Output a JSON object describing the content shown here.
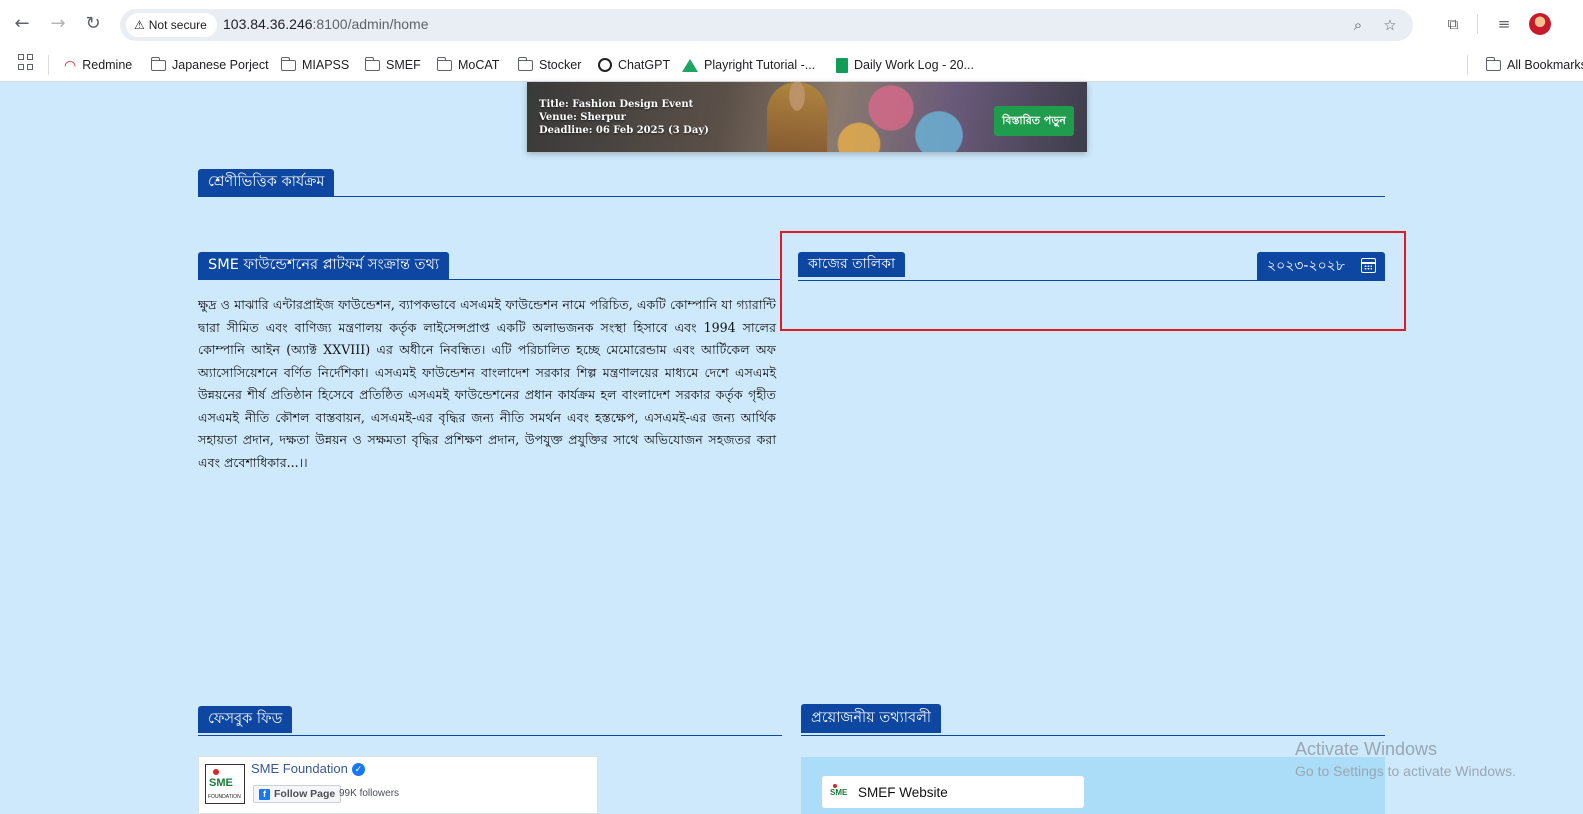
{
  "browser": {
    "security_label": "Not secure",
    "url_host": "103.84.36.246",
    "url_rest": ":8100/admin/home",
    "bookmarks": [
      {
        "label": "Redmine",
        "icon": "redmine-icon"
      },
      {
        "label": "Japanese Porject",
        "icon": "folder-icon"
      },
      {
        "label": "MIAPSS",
        "icon": "folder-icon"
      },
      {
        "label": "SMEF",
        "icon": "folder-icon"
      },
      {
        "label": "MoCAT",
        "icon": "folder-icon"
      },
      {
        "label": "Stocker",
        "icon": "folder-icon"
      },
      {
        "label": "ChatGPT",
        "icon": "chatgpt-icon"
      },
      {
        "label": "Playright Tutorial -...",
        "icon": "google-drive-icon"
      },
      {
        "label": "Daily Work Log - 20...",
        "icon": "google-sheets-icon"
      }
    ],
    "all_bookmarks": "All Bookmarks"
  },
  "event": {
    "title": "Title: Fashion Design Event",
    "venue": "Venue: Sherpur",
    "deadline": "Deadline: 06 Feb 2025 (3 Day)",
    "button": "বিস্তারিত পড়ুন"
  },
  "sections": {
    "category": "শ্রেণীভিত্তিক কার্যক্রম",
    "platform": "SME ফাউন্ডেশনের প্লাটফর্ম সংক্রান্ত তথ্য",
    "worklist": "কাজের তালিকা",
    "year_range": "২০২৩-২০২৮",
    "facebook": "ফেসবুক ফিড",
    "necessary_info": "প্রয়োজনীয় তথ্যাবলী"
  },
  "platform_text": "ক্ষুদ্র ও মাঝারি এন্টারপ্রাইজ ফাউন্ডেশন, ব্যাপকভাবে এসএমই ফাউন্ডেশন নামে পরিচিত, একটি কোম্পানি যা গ্যারান্টি দ্বারা সীমিত এবং বাণিজ্য মন্ত্রণালয় কর্তৃক লাইসেন্সপ্রাপ্ত একটি অলাভজনক সংস্থা হিসাবে এবং 1994 সালের কোম্পানি আইন (অ্যাক্ট XXVIII) এর অধীনে নিবন্ধিত। এটি পরিচালিত হচ্ছে মেমোরেন্ডাম এবং আর্টিকেল অফ অ্যাসোসিয়েশনে বর্ণিত নির্দেশিকা। এসএমই ফাউন্ডেশন বাংলাদেশ সরকার শিল্প মন্ত্রণালয়ের মাধ্যমে দেশে এসএমই উন্নয়নের শীর্ষ প্রতিষ্ঠান হিসেবে প্রতিষ্ঠিত এসএমই ফাউন্ডেশনের প্রধান কার্যক্রম হল বাংলাদেশ সরকার কর্তৃক গৃহীত এসএমই নীতি কৌশল বাস্তবায়ন, এসএমই-এর বৃদ্ধির জন্য নীতি সমর্থন এবং হস্তক্ষেপ, এসএমই-এর জন্য আর্থিক সহায়তা প্রদান, দক্ষতা উন্নয়ন ও সক্ষমতা বৃদ্ধির প্রশিক্ষণ প্রদান, উপযুক্ত প্রযুক্তির সাথে অভিযোজন সহজতর করা এবং প্রবেশাধিকার...।।",
  "facebook": {
    "page_name": "SME Foundation",
    "follow_label": "Follow Page",
    "followers": "99K followers",
    "logo_text": "SME",
    "logo_sub": "FOUNDATION"
  },
  "links": {
    "smef_website": "SMEF Website",
    "logo_text": "SME"
  },
  "watermark": {
    "line1": "Activate Windows",
    "line2": "Go to Settings to activate Windows."
  },
  "colors": {
    "page_bg": "#cde9fb",
    "section_tab": "#0e47a1",
    "event_button": "#1f9d4c",
    "highlight": "#e01b24"
  }
}
